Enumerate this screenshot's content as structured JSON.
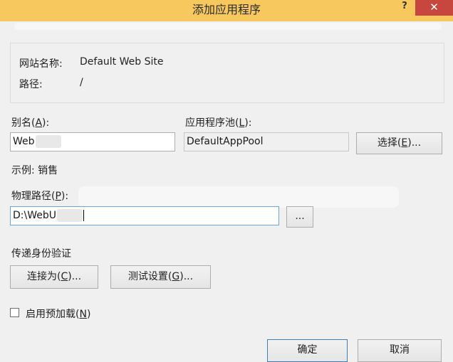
{
  "window": {
    "title": "添加应用程序",
    "help_label": "?",
    "close_label": "✕"
  },
  "site_info": {
    "site_name_label": "网站名称:",
    "site_name_value": "Default Web Site",
    "path_label": "路径:",
    "path_value": "/"
  },
  "alias": {
    "label_prefix": "别名(",
    "label_key": "A",
    "label_suffix": "):",
    "value": "Web"
  },
  "app_pool": {
    "label_prefix": "应用程序池(",
    "label_key": "L",
    "label_suffix": "):",
    "value": "DefaultAppPool",
    "select_prefix": "选择(",
    "select_key": "E",
    "select_suffix": ")..."
  },
  "example": {
    "text": "示例: 销售"
  },
  "physical_path": {
    "label_prefix": "物理路径(",
    "label_key": "P",
    "label_suffix": "):",
    "value": "D:\\WebU",
    "browse_label": "..."
  },
  "pass_through_auth": {
    "heading": "传递身份验证",
    "connect_prefix": "连接为(",
    "connect_key": "C",
    "connect_suffix": ")...",
    "test_prefix": "测试设置(",
    "test_key": "G",
    "test_suffix": ")..."
  },
  "preload": {
    "label_prefix": "启用预加载(",
    "label_key": "N",
    "label_suffix": ")",
    "checked": false
  },
  "footer": {
    "ok_label": "确定",
    "cancel_label": "取消"
  },
  "colors": {
    "titlebar": "#f7c85e",
    "close_button": "#c7473e",
    "dialog_background": "#f0f0f0",
    "focus_border": "#6aa5e0"
  }
}
